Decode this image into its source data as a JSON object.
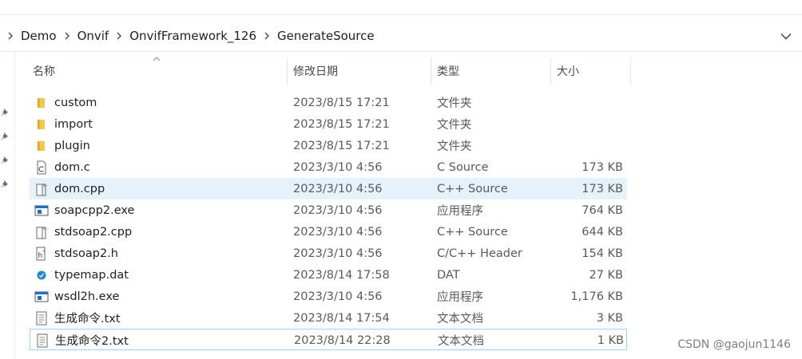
{
  "breadcrumb": [
    {
      "label": "Demo"
    },
    {
      "label": "Onvif"
    },
    {
      "label": "OnvifFramework_126"
    },
    {
      "label": "GenerateSource"
    }
  ],
  "columns": {
    "name": "名称",
    "date": "修改日期",
    "type": "类型",
    "size": "大小"
  },
  "files": [
    {
      "name": "custom",
      "date": "2023/8/15 17:21",
      "type": "文件夹",
      "size": "",
      "icon": "folder-icon"
    },
    {
      "name": "import",
      "date": "2023/8/15 17:21",
      "type": "文件夹",
      "size": "",
      "icon": "folder-icon"
    },
    {
      "name": "plugin",
      "date": "2023/8/15 17:21",
      "type": "文件夹",
      "size": "",
      "icon": "folder-icon"
    },
    {
      "name": "dom.c",
      "date": "2023/3/10 4:56",
      "type": "C Source",
      "size": "173 KB",
      "icon": "c-source-file-icon"
    },
    {
      "name": "dom.cpp",
      "date": "2023/3/10 4:56",
      "type": "C++ Source",
      "size": "173 KB",
      "icon": "cpp-source-file-icon"
    },
    {
      "name": "soapcpp2.exe",
      "date": "2023/3/10 4:56",
      "type": "应用程序",
      "size": "764 KB",
      "icon": "exe-file-icon"
    },
    {
      "name": "stdsoap2.cpp",
      "date": "2023/3/10 4:56",
      "type": "C++ Source",
      "size": "644 KB",
      "icon": "cpp-source-file-icon"
    },
    {
      "name": "stdsoap2.h",
      "date": "2023/3/10 4:56",
      "type": "C/C++ Header",
      "size": "154 KB",
      "icon": "header-file-icon"
    },
    {
      "name": "typemap.dat",
      "date": "2023/8/14 17:58",
      "type": "DAT",
      "size": "27 KB",
      "icon": "dat-file-icon"
    },
    {
      "name": "wsdl2h.exe",
      "date": "2023/3/10 4:56",
      "type": "应用程序",
      "size": "1,176 KB",
      "icon": "exe-file-icon"
    },
    {
      "name": "生成命令.txt",
      "date": "2023/8/14 17:54",
      "type": "文本文档",
      "size": "3 KB",
      "icon": "text-file-icon"
    },
    {
      "name": "生成命令2.txt",
      "date": "2023/8/14 22:28",
      "type": "文本文档",
      "size": "1 KB",
      "icon": "text-file-icon"
    }
  ],
  "watermark": "CSDN @gaojun1146",
  "colors": {
    "selected_row": "#e5f1fb",
    "focus_border": "#99d1ff",
    "folder": "#f4c84a",
    "exe_blue": "#1e6fc6",
    "cpp_purple": "#8a3fb5"
  }
}
